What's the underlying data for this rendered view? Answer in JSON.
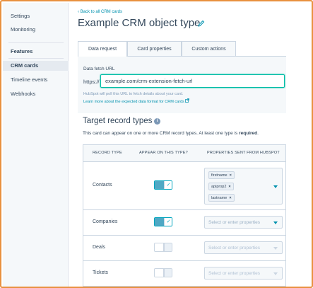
{
  "sidebar": {
    "items_top": [
      {
        "label": "Settings"
      },
      {
        "label": "Monitoring"
      }
    ],
    "section_label": "Features",
    "items_features": [
      {
        "label": "CRM cards",
        "active": true
      },
      {
        "label": "Timeline events"
      },
      {
        "label": "Webhooks"
      }
    ]
  },
  "header": {
    "back_link": "‹  Back to all CRM cards",
    "title": "Example CRM object type"
  },
  "tabs": [
    {
      "label": "Data request",
      "active": true
    },
    {
      "label": "Card properties"
    },
    {
      "label": "Custom actions"
    }
  ],
  "data_fetch": {
    "label": "Data fetch URL",
    "prefix": "https://",
    "value": "example.com/crm-extension-fetch-url",
    "help_text": "HubSpot will poll this URL to fetch details about your card.",
    "help_link": "Learn more about the expected data format for CRM cards"
  },
  "target": {
    "title": "Target record types",
    "desc_prefix": "This card can appear on one or more CRM record types. At least one type is ",
    "desc_bold": "required",
    "desc_suffix": "."
  },
  "table": {
    "headers": [
      "RECORD TYPE",
      "APPEAR ON THIS TYPE?",
      "PROPERTIES SENT FROM HUBSPOT"
    ],
    "rows": [
      {
        "record_type": "Contacts",
        "enabled": true,
        "properties": [
          "firstname",
          "apiprop2",
          "lastname"
        ]
      },
      {
        "record_type": "Companies",
        "enabled": true,
        "placeholder": "Select or enter properties"
      },
      {
        "record_type": "Deals",
        "enabled": false,
        "placeholder": "Select or enter properties"
      },
      {
        "record_type": "Tickets",
        "enabled": false,
        "placeholder": "Select or enter properties"
      }
    ]
  },
  "icons": {
    "edit": "pencil-icon",
    "info": "info-icon",
    "external": "external-link-icon",
    "check": "checkmark-icon",
    "remove": "close-icon",
    "dropdown": "caret-down-icon"
  },
  "colors": {
    "accent": "#0091ae",
    "toggle_on": "#4fa8c4",
    "frame": "#e8913f",
    "input_focus": "#00bda5"
  }
}
